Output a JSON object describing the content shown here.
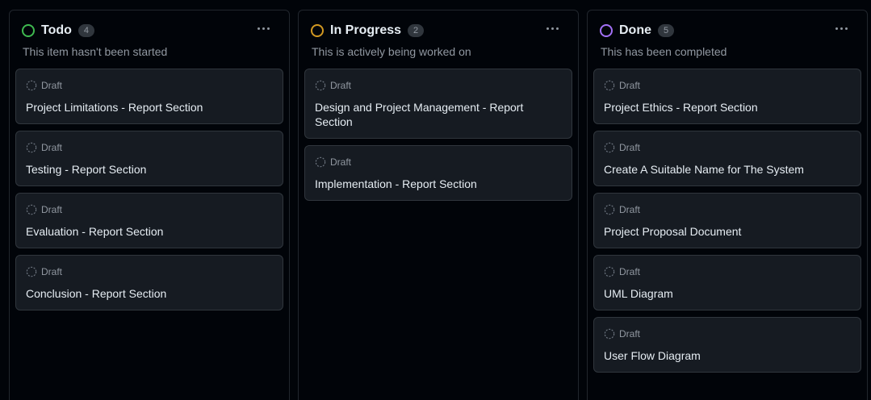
{
  "colors": {
    "todo": "#3fb950",
    "in_progress": "#d29922",
    "done": "#a371f7"
  },
  "columns": [
    {
      "title": "Todo",
      "count": "4",
      "description": "This item hasn't been started",
      "status_icon": "circle-icon",
      "cards": [
        {
          "status": "Draft",
          "title": "Project Limitations - Report Section"
        },
        {
          "status": "Draft",
          "title": "Testing - Report Section"
        },
        {
          "status": "Draft",
          "title": "Evaluation - Report Section"
        },
        {
          "status": "Draft",
          "title": "Conclusion - Report Section"
        }
      ]
    },
    {
      "title": "In Progress",
      "count": "2",
      "description": "This is actively being worked on",
      "status_icon": "circle-icon",
      "cards": [
        {
          "status": "Draft",
          "title": "Design and Project Management - Report Section"
        },
        {
          "status": "Draft",
          "title": "Implementation - Report Section"
        }
      ]
    },
    {
      "title": "Done",
      "count": "5",
      "description": "This has been completed",
      "status_icon": "circle-icon",
      "cards": [
        {
          "status": "Draft",
          "title": "Project Ethics - Report Section"
        },
        {
          "status": "Draft",
          "title": "Create A Suitable Name for The System"
        },
        {
          "status": "Draft",
          "title": "Project Proposal Document"
        },
        {
          "status": "Draft",
          "title": "UML Diagram"
        },
        {
          "status": "Draft",
          "title": "User Flow Diagram"
        }
      ]
    }
  ]
}
